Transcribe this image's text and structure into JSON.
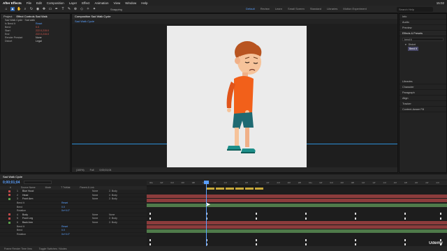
{
  "menubar": {
    "app": "After Effects",
    "items": [
      "File",
      "Edit",
      "Composition",
      "Layer",
      "Effect",
      "Animation",
      "View",
      "Window",
      "Help"
    ],
    "time": "15:02"
  },
  "toolbar": {
    "snapping": "Snapping",
    "workspaces": [
      "Default",
      "Review",
      "Learn",
      "Small Screen",
      "Standard",
      "Libraries",
      "Motion Experiment"
    ],
    "active_workspace": "Default",
    "search_placeholder": "Search Help"
  },
  "left_panel": {
    "tabs": [
      "Project",
      "Effect Controls Sad Walk"
    ],
    "layer_path": "Sad Walk Cycle · Sad walk",
    "rows": [
      {
        "label": "fx Bend It",
        "value": "Reset",
        "tone": "blue"
      },
      {
        "label": "Bend",
        "value": "0.0",
        "tone": "red"
      },
      {
        "label": "Start",
        "value": "222.0,215.0",
        "tone": "red"
      },
      {
        "label": "End",
        "value": "222.0,215.0",
        "tone": "red"
      },
      {
        "label": "Render Prestart",
        "value": "None",
        "tone": "plain"
      },
      {
        "label": "Distort",
        "value": "Legal",
        "tone": "plain"
      }
    ]
  },
  "comp_panel": {
    "tab": "Composition Sad Walk Cycle",
    "breadcrumb": "Sad Walk Cycle",
    "footer": [
      "(100%)",
      "Full",
      "0;00;01;04"
    ]
  },
  "right_panel": {
    "items": [
      "Info",
      "Audio",
      "Preview"
    ],
    "effects_title": "Effects & Presets",
    "search_value": "bend it",
    "presets_group": "Distort",
    "preset_name": "Bend It",
    "lower_items": [
      "Libraries",
      "Character",
      "Paragraph",
      "Align",
      "Tracker",
      "Content-Aware Fill"
    ]
  },
  "timeline": {
    "tabs": [
      "Sad Walk Cycle"
    ],
    "timecode": "0;00;01;04",
    "search_placeholder": "",
    "header": [
      "#",
      "Source Name",
      "Mode",
      "T TrkMat",
      "Parent & Link"
    ],
    "layers": [
      {
        "num": "1",
        "name": "Blue Hood",
        "mode": "None",
        "parent": "2. Body",
        "color": "#c04a4a",
        "sub": false
      },
      {
        "num": "2",
        "name": "Head",
        "mode": "None",
        "parent": "2. Body",
        "color": "#c04a4a",
        "sub": false
      },
      {
        "num": "3",
        "name": "Front Arm",
        "mode": "None",
        "parent": "2. Body",
        "color": "#5aa04a",
        "sub": false
      },
      {
        "num": "",
        "name": "Bend It",
        "value": "Reset",
        "sub": true
      },
      {
        "num": "",
        "name": "Bend",
        "value": "0.0",
        "sub": true
      },
      {
        "num": "",
        "name": "Rotation",
        "value": "0x+0.0°",
        "sub": true
      },
      {
        "num": "4",
        "name": "Body",
        "mode": "None",
        "parent": "None",
        "color": "#c04a4a",
        "sub": false
      },
      {
        "num": "5",
        "name": "Front Leg",
        "mode": "None",
        "parent": "2. Body",
        "color": "#c04a4a",
        "sub": false
      },
      {
        "num": "6",
        "name": "Back Arm",
        "mode": "None",
        "parent": "2. Body",
        "color": "#5aa04a",
        "sub": false
      },
      {
        "num": "",
        "name": "Bend It",
        "value": "Reset",
        "sub": true
      },
      {
        "num": "",
        "name": "Bend",
        "value": "0.0",
        "sub": true
      },
      {
        "num": "",
        "name": "Rotation",
        "value": "0x+0.0°",
        "sub": true
      }
    ],
    "ruler": [
      "00s",
      "02f",
      "04f",
      "06f",
      "08f",
      "10f",
      "12f",
      "14f",
      "16f",
      "18f",
      "20f",
      "22f",
      "24f",
      "26f",
      "28f",
      "01s",
      "02f",
      "04f",
      "06f",
      "08f",
      "10f",
      "12f",
      "14f",
      "16f",
      "18f",
      "20f",
      "22f",
      "24f"
    ],
    "footer": [
      "Frame Render Time  0ms",
      "Toggle Switches / Modes"
    ]
  },
  "watermark": "Udemy"
}
